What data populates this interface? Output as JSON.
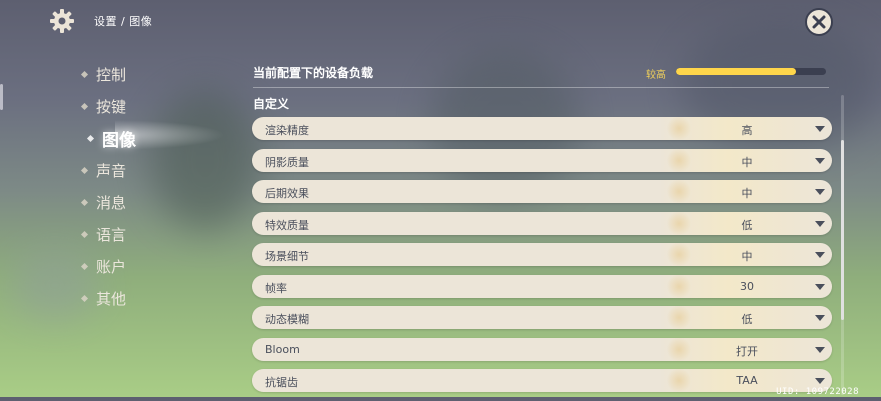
{
  "header": {
    "breadcrumb": "设置 / 图像",
    "settings_icon": "gear-icon",
    "close_icon": "close-icon"
  },
  "sidebar": {
    "items": [
      {
        "label": "控制",
        "active": false
      },
      {
        "label": "按键",
        "active": false
      },
      {
        "label": "图像",
        "active": true
      },
      {
        "label": "声音",
        "active": false
      },
      {
        "label": "消息",
        "active": false
      },
      {
        "label": "语言",
        "active": false
      },
      {
        "label": "账户",
        "active": false
      },
      {
        "label": "其他",
        "active": false
      }
    ]
  },
  "device_load": {
    "title": "当前配置下的设备负载",
    "level_label": "较高",
    "level_fraction": 0.8
  },
  "custom": {
    "title": "自定义",
    "settings": [
      {
        "label": "渲染精度",
        "value": "高"
      },
      {
        "label": "阴影质量",
        "value": "中"
      },
      {
        "label": "后期效果",
        "value": "中"
      },
      {
        "label": "特效质量",
        "value": "低"
      },
      {
        "label": "场景细节",
        "value": "中"
      },
      {
        "label": "帧率",
        "value": "30"
      },
      {
        "label": "动态模糊",
        "value": "低"
      },
      {
        "label": "Bloom",
        "value": "打开"
      },
      {
        "label": "抗锯齿",
        "value": "TAA"
      }
    ]
  },
  "footer": {
    "uid": "UID: 109722028"
  },
  "colors": {
    "panel": "#ece5d8",
    "text_dark": "#4a4f5c",
    "accent_yellow": "#ffd64b",
    "bar_track": "#3b3f50"
  }
}
